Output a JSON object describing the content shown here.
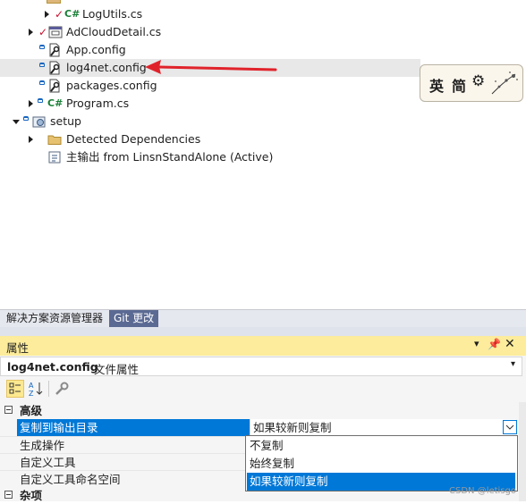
{
  "solution_explorer": {
    "items": [
      {
        "label": "LogUtils.cs",
        "prefix": "C#",
        "status": "✓"
      },
      {
        "label": "AdCloudDetail.cs",
        "status": "✓"
      },
      {
        "label": "App.config"
      },
      {
        "label": "log4net.config"
      },
      {
        "label": "packages.config"
      },
      {
        "label": "Program.cs",
        "prefix": "C#"
      },
      {
        "label": "setup"
      },
      {
        "label": "Detected Dependencies"
      },
      {
        "label": "主输出 from LinsnStandAlone (Active)"
      }
    ]
  },
  "ime_toolbar": {
    "lang": "英",
    "mode": "简"
  },
  "bottom_tabs": [
    "解决方案资源管理器",
    "Git 更改"
  ],
  "properties": {
    "title": "属性",
    "object_name": "log4net.config",
    "object_type": "文件属性",
    "category_advanced": "高级",
    "category_misc": "杂项",
    "rows": [
      {
        "name": "复制到输出目录",
        "value": "如果较新则复制"
      },
      {
        "name": "生成操作",
        "value": ""
      },
      {
        "name": "自定义工具",
        "value": ""
      },
      {
        "name": "自定义工具命名空间",
        "value": ""
      }
    ],
    "dropdown_options": [
      "不复制",
      "始终复制",
      "如果较新则复制"
    ]
  },
  "watermark": "CSDN @letisgo"
}
